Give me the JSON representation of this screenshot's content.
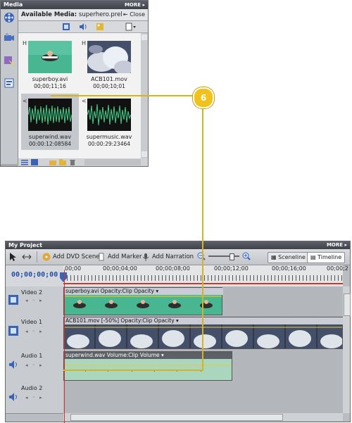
{
  "media": {
    "title": "Media",
    "more": "MORE ▸",
    "header_label": "Available Media:",
    "header_file": " superhero.prel",
    "close_label": "⇤ Close",
    "items": [
      {
        "name": "superboy.avi",
        "duration": "00;00;11;16",
        "kind": "video-green"
      },
      {
        "name": "ACB101.mov",
        "duration": "00;00;10;01",
        "kind": "video-clouds"
      },
      {
        "name": "superwind.wav",
        "duration": "00:00:12:08584",
        "kind": "audio"
      },
      {
        "name": "supermusic.wav",
        "duration": "00:00:29:23464",
        "kind": "audio"
      }
    ]
  },
  "callout": {
    "number": "6",
    "color": "#f0c21b"
  },
  "project": {
    "title": "My Project",
    "more": "MORE ▸",
    "toolbar": {
      "add_dvd_scene": "Add DVD Scene",
      "add_marker": "Add Marker",
      "add_narration": "Add Narration",
      "sceneline": "Sceneline",
      "timeline": "Timeline"
    },
    "timecode": "00;00;00;00",
    "ruler": [
      "00;00",
      "00;00;04;00",
      "00;00;08;00",
      "00;00;12;00",
      "00;00;16;00",
      "00;00;2"
    ],
    "tracks": [
      {
        "name": "Video 2",
        "clip": "superboy.avi",
        "effect": "Opacity:Clip Opacity ▾"
      },
      {
        "name": "Video 1",
        "clip": "ACB101.mov [-50%]",
        "effect": "Opacity:Clip Opacity ▾"
      },
      {
        "name": "Audio 1",
        "clip": "superwind.wav",
        "effect": "Volume:Clip Volume ▾"
      },
      {
        "name": "Audio 2",
        "clip": "",
        "effect": ""
      }
    ]
  },
  "colors": {
    "accent": "#1f4fa8",
    "playhead": "#d2342d",
    "green_clip": "#3fb089",
    "callout": "#f0c21b"
  }
}
